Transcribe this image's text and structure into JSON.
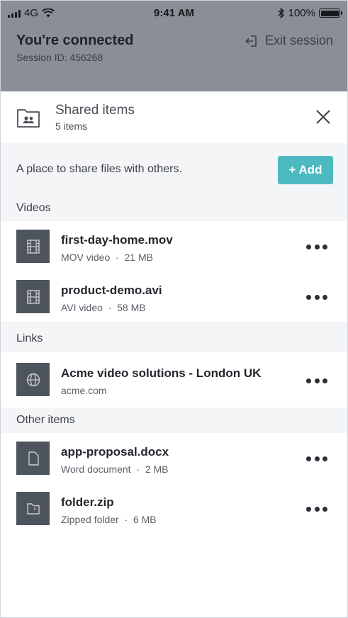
{
  "status_bar": {
    "carrier": "4G",
    "time": "9:41 AM",
    "battery": "100%"
  },
  "session": {
    "title": "You're connected",
    "id_text": "Session ID: 456268",
    "exit_label": "Exit session"
  },
  "panel": {
    "title": "Shared items",
    "count": "5 items",
    "intro": "A place to share files with others.",
    "add_label": "+ Add"
  },
  "sections": {
    "videos": {
      "label": "Videos",
      "items": [
        {
          "name": "first-day-home.mov",
          "type": "MOV video",
          "size": "21 MB",
          "icon": "film-icon"
        },
        {
          "name": "product-demo.avi",
          "type": "AVI video",
          "size": "58 MB",
          "icon": "film-icon"
        }
      ]
    },
    "links": {
      "label": "Links",
      "items": [
        {
          "name": "Acme video solutions - London UK",
          "type": "acme.com",
          "icon": "globe-icon"
        }
      ]
    },
    "other": {
      "label": "Other items",
      "items": [
        {
          "name": "app-proposal.docx",
          "type": "Word document",
          "size": "2 MB",
          "icon": "document-icon"
        },
        {
          "name": "folder.zip",
          "type": "Zipped folder",
          "size": "6 MB",
          "icon": "folder-icon"
        }
      ]
    }
  },
  "separator": "·",
  "colors": {
    "accent": "#4cbac0",
    "thumb_bg": "#4e545e",
    "overlay": "#8a8e96"
  }
}
